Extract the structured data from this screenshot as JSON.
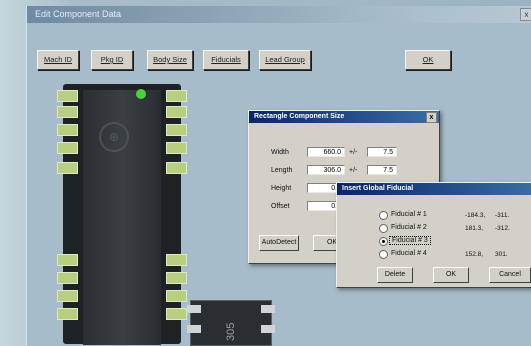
{
  "main_window": {
    "title": "Edit Component Data",
    "close_glyph": "x",
    "toolbar": {
      "buttons": [
        "Mach ID",
        "Pkg ID",
        "Body Size",
        "Fiducials",
        "Lead Group",
        "OK"
      ]
    }
  },
  "rect_dialog": {
    "title": "Rectangle Component Size",
    "close_glyph": "x",
    "rows": [
      {
        "label": "Width",
        "value": "660.0",
        "tol": "7.5"
      },
      {
        "label": "Length",
        "value": "306.0",
        "tol": "7.5"
      },
      {
        "label": "Height",
        "value": "0.0"
      },
      {
        "label": "Offset",
        "value": "0.0"
      }
    ],
    "plusminus": "+/-",
    "auto_button": "AutoDetect",
    "ok_button": "OK"
  },
  "fiducial_dialog": {
    "title": "Insert Global Fiducial",
    "items": [
      {
        "label": "Fiducial # 1",
        "x": "-184.3,",
        "y": "-311."
      },
      {
        "label": "Fiducial # 2",
        "x": "181.3,",
        "y": "-312."
      },
      {
        "label": "Fiducial # 3",
        "x": "",
        "y": ""
      },
      {
        "label": "Fiducial # 4",
        "x": "152.8,",
        "y": "301."
      }
    ],
    "selected_index": 2,
    "buttons": {
      "delete": "Delete",
      "ok": "OK",
      "cancel": "Cancel"
    }
  },
  "component": {
    "part_marking": "305"
  }
}
